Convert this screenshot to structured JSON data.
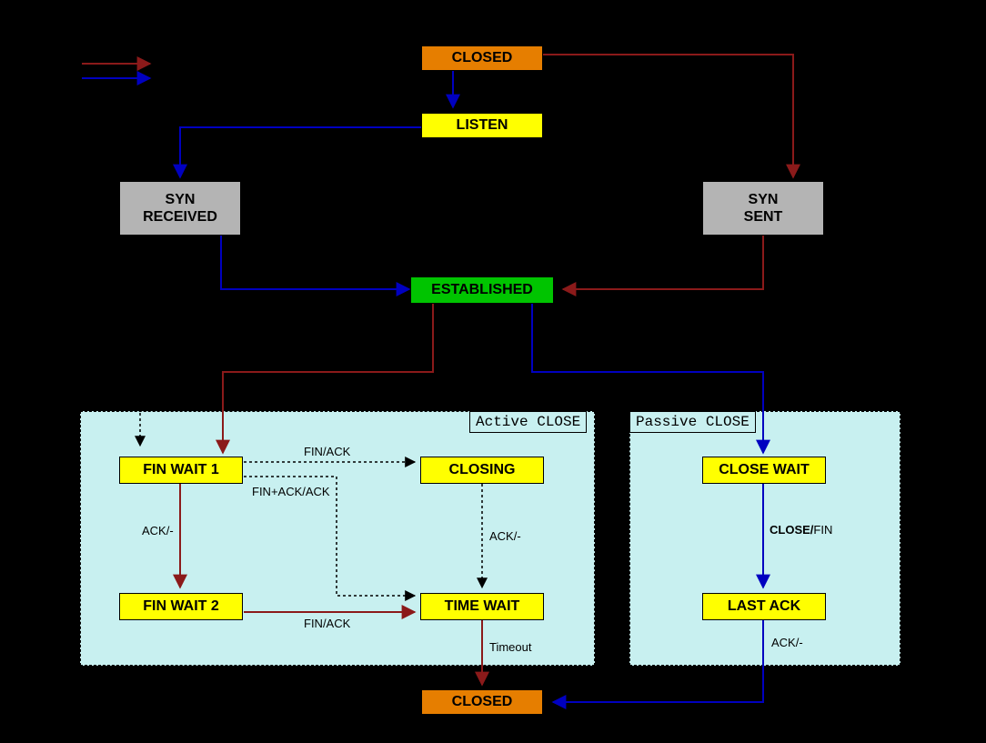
{
  "states": {
    "closed_top": "CLOSED",
    "listen": "LISTEN",
    "syn_received": "SYN\nRECEIVED",
    "syn_sent": "SYN\nSENT",
    "established": "ESTABLISHED",
    "fin_wait_1": "FIN WAIT 1",
    "fin_wait_2": "FIN WAIT 2",
    "closing": "CLOSING",
    "time_wait": "TIME WAIT",
    "close_wait": "CLOSE WAIT",
    "last_ack": "LAST ACK",
    "closed_bottom": "CLOSED"
  },
  "regions": {
    "active_close": "Active CLOSE",
    "passive_close": "Passive CLOSE"
  },
  "edge_labels": {
    "fw1_closing": "FIN/ACK",
    "fw1_timewait": "FIN+ACK/ACK",
    "fw1_fw2": "ACK/-",
    "closing_timewait": "ACK/-",
    "fw2_timewait": "FIN/ACK",
    "timewait_closed": "Timeout",
    "closewait_lastack_bold": "CLOSE/",
    "closewait_lastack_plain": "FIN",
    "lastack_closed": "ACK/-"
  },
  "colors": {
    "client_line": "#8b1a1a",
    "server_line": "#0000c0",
    "data_line": "#000000"
  }
}
